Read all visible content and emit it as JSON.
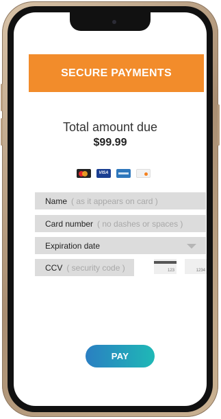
{
  "header": {
    "title": "SECURE PAYMENTS"
  },
  "summary": {
    "label": "Total amount due",
    "amount": "$99.99"
  },
  "payment_methods": [
    {
      "icon": "mastercard-icon"
    },
    {
      "icon": "visa-icon",
      "label": "VISA"
    },
    {
      "icon": "amex-icon"
    },
    {
      "icon": "discover-icon"
    }
  ],
  "form": {
    "name": {
      "label": "Name",
      "placeholder": "( as it appears on card )"
    },
    "card_number": {
      "label": "Card number",
      "placeholder": "( no dashes or spaces )"
    },
    "expiration": {
      "label": "Expiration date"
    },
    "ccv": {
      "label": "CCV",
      "placeholder": "( security code )",
      "back_sample": "123",
      "front_sample": "1234"
    }
  },
  "pay_button": {
    "label": "PAY"
  },
  "colors": {
    "header": "#f28c2b",
    "pay_start": "#2a7fc2",
    "pay_end": "#1fb8b6",
    "field": "#dcdcdc"
  }
}
